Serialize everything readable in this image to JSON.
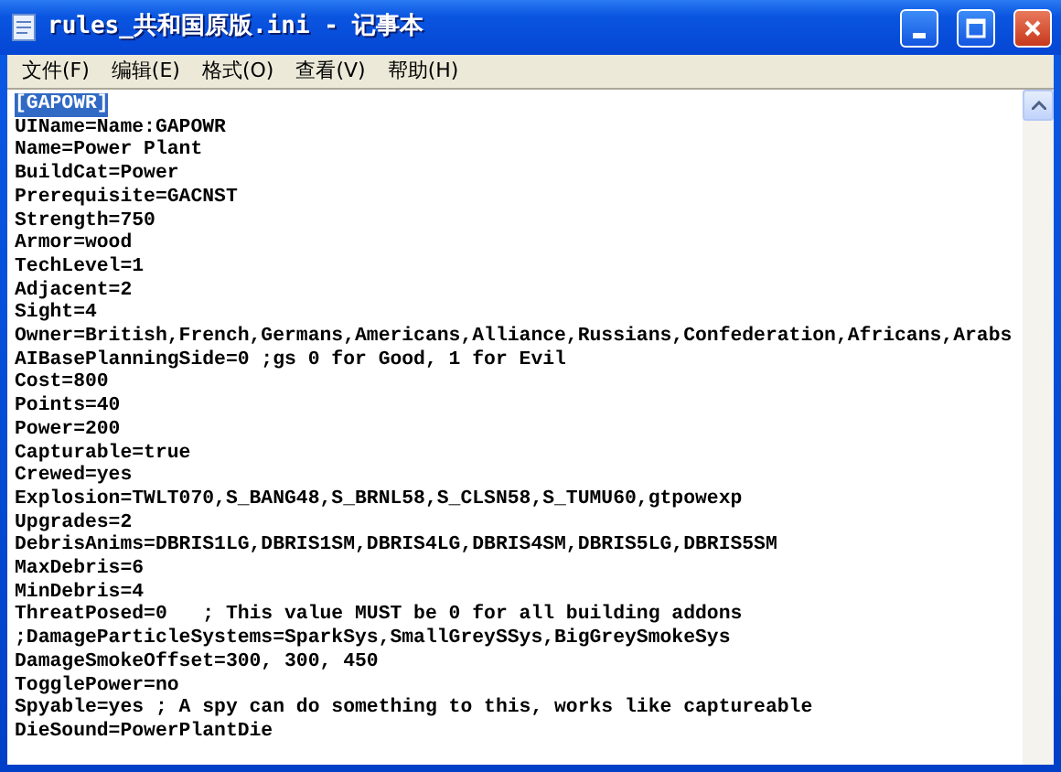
{
  "window": {
    "title": "rules_共和国原版.ini - 记事本"
  },
  "menu": [
    "文件(F)",
    "编辑(E)",
    "格式(O)",
    "查看(V)",
    "帮助(H)"
  ],
  "lines": [
    {
      "text": "[GAPOWR]",
      "selected": true
    },
    {
      "text": "UIName=Name:GAPOWR",
      "selected": false
    },
    {
      "text": "Name=Power Plant",
      "selected": false
    },
    {
      "text": "BuildCat=Power",
      "selected": false
    },
    {
      "text": "Prerequisite=GACNST",
      "selected": false
    },
    {
      "text": "Strength=750",
      "selected": false
    },
    {
      "text": "Armor=wood",
      "selected": false
    },
    {
      "text": "TechLevel=1",
      "selected": false
    },
    {
      "text": "Adjacent=2",
      "selected": false
    },
    {
      "text": "Sight=4",
      "selected": false
    },
    {
      "text": "Owner=British,French,Germans,Americans,Alliance,Russians,Confederation,Africans,Arabs",
      "selected": false
    },
    {
      "text": "AIBasePlanningSide=0 ;gs 0 for Good, 1 for Evil",
      "selected": false
    },
    {
      "text": "Cost=800",
      "selected": false
    },
    {
      "text": "Points=40",
      "selected": false
    },
    {
      "text": "Power=200",
      "selected": false
    },
    {
      "text": "Capturable=true",
      "selected": false
    },
    {
      "text": "Crewed=yes",
      "selected": false
    },
    {
      "text": "Explosion=TWLT070,S_BANG48,S_BRNL58,S_CLSN58,S_TUMU60,gtpowexp",
      "selected": false
    },
    {
      "text": "Upgrades=2",
      "selected": false
    },
    {
      "text": "DebrisAnims=DBRIS1LG,DBRIS1SM,DBRIS4LG,DBRIS4SM,DBRIS5LG,DBRIS5SM",
      "selected": false
    },
    {
      "text": "MaxDebris=6",
      "selected": false
    },
    {
      "text": "MinDebris=4",
      "selected": false
    },
    {
      "text": "ThreatPosed=0   ; This value MUST be 0 for all building addons",
      "selected": false
    },
    {
      "text": ";DamageParticleSystems=SparkSys,SmallGreySSys,BigGreySmokeSys",
      "selected": false
    },
    {
      "text": "DamageSmokeOffset=300, 300, 450",
      "selected": false
    },
    {
      "text": "TogglePower=no",
      "selected": false
    },
    {
      "text": "Spyable=yes ; A spy can do something to this, works like captureable",
      "selected": false
    },
    {
      "text": "DieSound=PowerPlantDie",
      "selected": false
    }
  ]
}
